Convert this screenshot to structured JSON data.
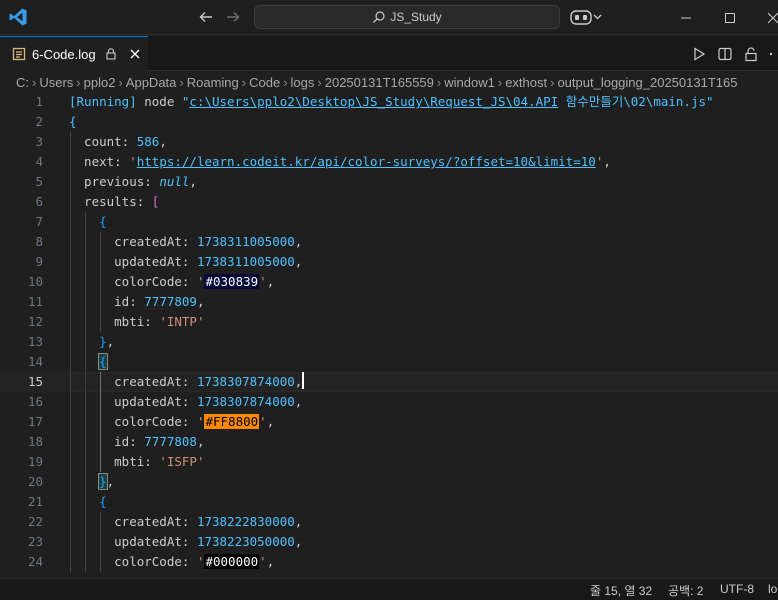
{
  "titlebar": {
    "search_text": "JS_Study"
  },
  "tab": {
    "label": "6-Code.log"
  },
  "breadcrumb": [
    "C:",
    "Users",
    "pplo2",
    "AppData",
    "Roaming",
    "Code",
    "logs",
    "20250131T165559",
    "window1",
    "exthost",
    "output_logging_20250131T165"
  ],
  "editor": {
    "current_line": 15,
    "lines": [
      {
        "n": "1",
        "parts": [
          [
            "t-running",
            "[Running]"
          ],
          [
            "t-plain",
            " node "
          ],
          [
            "t-running",
            "\""
          ],
          [
            "t-path",
            "c:\\Users\\pplo2\\Desktop\\JS_Study\\Request_JS\\04.API"
          ],
          [
            "t-running",
            " 함수만들기\\02\\main.js\""
          ]
        ]
      },
      {
        "n": "2",
        "parts": [
          [
            "t-brace",
            "{"
          ]
        ]
      },
      {
        "n": "3",
        "parts": [
          [
            "t-key",
            "  count: "
          ],
          [
            "t-num",
            "586"
          ],
          [
            "t-plain",
            ","
          ]
        ]
      },
      {
        "n": "4",
        "parts": [
          [
            "t-key",
            "  next: "
          ],
          [
            "t-str",
            "'"
          ],
          [
            "t-link",
            "https://learn.codeit.kr/api/color-surveys/?offset=10&limit=10"
          ],
          [
            "t-str",
            "'"
          ],
          [
            "t-plain",
            ","
          ]
        ]
      },
      {
        "n": "5",
        "parts": [
          [
            "t-key",
            "  previous: "
          ],
          [
            "t-null",
            "null"
          ],
          [
            "t-plain",
            ","
          ]
        ]
      },
      {
        "n": "6",
        "parts": [
          [
            "t-key",
            "  results: "
          ],
          [
            "t-brack",
            "["
          ]
        ]
      },
      {
        "n": "7",
        "parts": [
          [
            "t-plain",
            "    "
          ],
          [
            "t-obj",
            "{"
          ]
        ]
      },
      {
        "n": "8",
        "parts": [
          [
            "t-key",
            "      createdAt: "
          ],
          [
            "t-num",
            "1738311005000"
          ],
          [
            "t-plain",
            ","
          ]
        ]
      },
      {
        "n": "9",
        "parts": [
          [
            "t-key",
            "      updatedAt: "
          ],
          [
            "t-num",
            "1738311005000"
          ],
          [
            "t-plain",
            ","
          ]
        ]
      },
      {
        "n": "10",
        "parts": [
          [
            "t-key",
            "      colorCode: "
          ],
          [
            "t-str",
            "'"
          ],
          [
            "swatch-dark",
            "#030839"
          ],
          [
            "t-str",
            "'"
          ],
          [
            "t-plain",
            ","
          ]
        ]
      },
      {
        "n": "11",
        "parts": [
          [
            "t-key",
            "      id: "
          ],
          [
            "t-num",
            "7777809"
          ],
          [
            "t-plain",
            ","
          ]
        ]
      },
      {
        "n": "12",
        "parts": [
          [
            "t-key",
            "      mbti: "
          ],
          [
            "t-str",
            "'INTP'"
          ]
        ]
      },
      {
        "n": "13",
        "parts": [
          [
            "t-plain",
            "    "
          ],
          [
            "t-obj",
            "}"
          ],
          [
            "t-plain",
            ","
          ]
        ]
      },
      {
        "n": "14",
        "parts": [
          [
            "t-plain",
            "    "
          ],
          [
            "t-obj br-hl",
            "{"
          ]
        ]
      },
      {
        "n": "15",
        "parts": [
          [
            "t-key",
            "      createdAt: "
          ],
          [
            "t-num",
            "1738307874000"
          ],
          [
            "t-plain",
            ","
          ]
        ]
      },
      {
        "n": "16",
        "parts": [
          [
            "t-key",
            "      updatedAt: "
          ],
          [
            "t-num",
            "1738307874000"
          ],
          [
            "t-plain",
            ","
          ]
        ]
      },
      {
        "n": "17",
        "parts": [
          [
            "t-key",
            "      colorCode: "
          ],
          [
            "t-str",
            "'"
          ],
          [
            "swatch-orange",
            "#FF8800"
          ],
          [
            "t-str",
            "'"
          ],
          [
            "t-plain",
            ","
          ]
        ]
      },
      {
        "n": "18",
        "parts": [
          [
            "t-key",
            "      id: "
          ],
          [
            "t-num",
            "7777808"
          ],
          [
            "t-plain",
            ","
          ]
        ]
      },
      {
        "n": "19",
        "parts": [
          [
            "t-key",
            "      mbti: "
          ],
          [
            "t-str",
            "'ISFP'"
          ]
        ]
      },
      {
        "n": "20",
        "parts": [
          [
            "t-plain",
            "    "
          ],
          [
            "t-obj br-hl",
            "}"
          ],
          [
            "t-plain",
            ","
          ]
        ]
      },
      {
        "n": "21",
        "parts": [
          [
            "t-plain",
            "    "
          ],
          [
            "t-obj",
            "{"
          ]
        ]
      },
      {
        "n": "22",
        "parts": [
          [
            "t-key",
            "      createdAt: "
          ],
          [
            "t-num",
            "1738222830000"
          ],
          [
            "t-plain",
            ","
          ]
        ]
      },
      {
        "n": "23",
        "parts": [
          [
            "t-key",
            "      updatedAt: "
          ],
          [
            "t-num",
            "1738223050000"
          ],
          [
            "t-plain",
            ","
          ]
        ]
      },
      {
        "n": "24",
        "parts": [
          [
            "t-key",
            "      colorCode: "
          ],
          [
            "t-str",
            "'"
          ],
          [
            "swatch-black",
            "#000000"
          ],
          [
            "t-str",
            "'"
          ],
          [
            "t-plain",
            ","
          ]
        ]
      }
    ]
  },
  "statusbar": {
    "position": "줄 15, 열 32",
    "spaces": "공백: 2",
    "encoding": "UTF-8",
    "language": "lo"
  }
}
